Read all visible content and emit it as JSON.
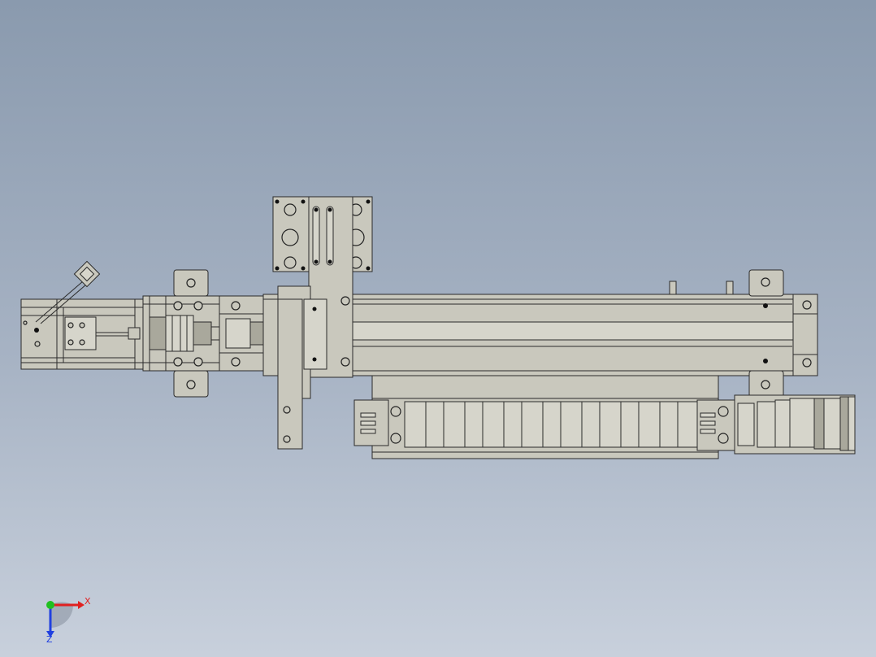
{
  "viewport": {
    "background_top": "#8a9aae",
    "background_bottom": "#c8d0dc",
    "model_fill": "#c9c8bd",
    "edge_color": "#2a2a2a"
  },
  "axis_triad": {
    "x_label": "X",
    "z_label": "Z",
    "x_color": "#e02020",
    "y_color": "#20c020",
    "z_color": "#2040e0"
  }
}
